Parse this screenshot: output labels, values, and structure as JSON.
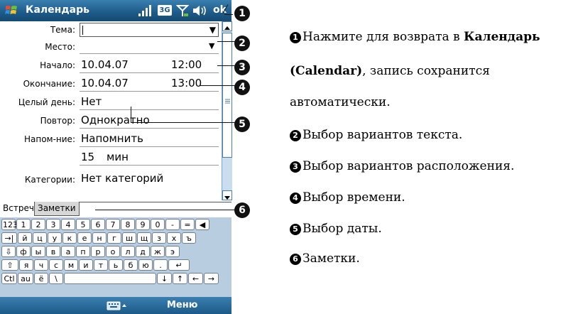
{
  "titlebar": {
    "app_title": "Календарь",
    "ok_label": "ok",
    "icons": [
      "windows-start-icon",
      "signal-icon",
      "3g-icon",
      "antenna-icon",
      "volume-icon"
    ],
    "badge_3g": "3G"
  },
  "form": {
    "fields": [
      {
        "label": "Тема:",
        "value": ""
      },
      {
        "label": "Место:",
        "value": ""
      },
      {
        "label": "Начало:",
        "value": "10.04.07",
        "value2": "12:00"
      },
      {
        "label": "Окончание:",
        "value": "10.04.07",
        "value2": "13:00"
      },
      {
        "label": "Целый день:",
        "value": "Нет"
      },
      {
        "label": "Повтор:",
        "value": "Однократно"
      },
      {
        "label": "Напом-ние:",
        "value": "Напомнить"
      },
      {
        "label": "",
        "value": "15",
        "value2": "мин"
      },
      {
        "label": "Категории:",
        "value": "Нет категорий"
      }
    ]
  },
  "tabs": [
    "Встреча",
    "Заметки"
  ],
  "keyboard": {
    "rows": [
      [
        "123",
        "1",
        "2",
        "3",
        "4",
        "5",
        "6",
        "7",
        "8",
        "9",
        "0",
        "-",
        "=",
        "◀"
      ],
      [
        "→|",
        "й",
        "ц",
        "у",
        "к",
        "е",
        "н",
        "г",
        "ш",
        "щ",
        "з",
        "х",
        "ъ"
      ],
      [
        "⇩",
        "ф",
        "ы",
        "в",
        "а",
        "п",
        "р",
        "о",
        "л",
        "д",
        "ж",
        "э"
      ],
      [
        "⇧",
        "я",
        "ч",
        "с",
        "м",
        "и",
        "т",
        "ь",
        "б",
        "ю",
        ".",
        "↵"
      ],
      [
        "Ctl",
        "au",
        "ё",
        "\\",
        " ",
        "↓",
        "↑",
        "←",
        "→"
      ]
    ]
  },
  "menubar": {
    "menu_label": "Меню"
  },
  "callouts": [
    "❶",
    "❷",
    "❸",
    "❹",
    "❺",
    "❻"
  ],
  "descriptions": {
    "d1_text": "Нажмите для возврата в ",
    "d1_bold": "Календарь",
    "d1_bold2": "(Calendar)",
    "d1_text2": ", запись сохранится",
    "d1_text3": "автоматически.",
    "d2": "Выбор вариантов текста.",
    "d3": "Выбор вариантов расположения.",
    "d4": "Выбор времени.",
    "d5": "Выбор даты.",
    "d6": "Заметки.",
    "markers": [
      "1",
      "2",
      "3",
      "4",
      "5",
      "6"
    ]
  }
}
